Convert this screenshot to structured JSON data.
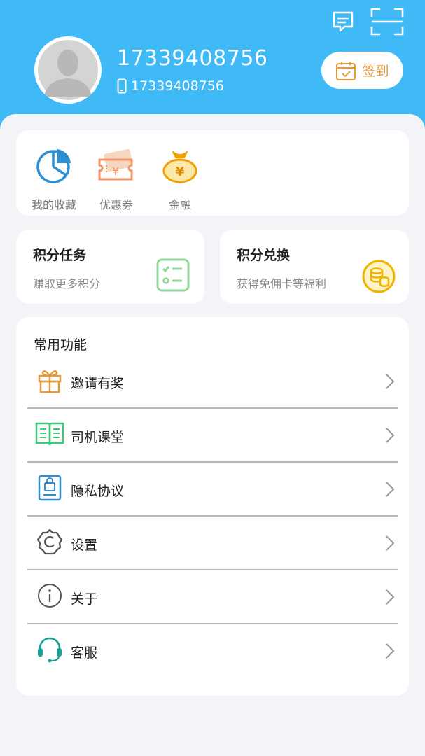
{
  "header": {
    "username": "17339408756",
    "phone": "17339408756",
    "checkin_label": "签到"
  },
  "quick_actions": [
    {
      "label": "我的收藏",
      "icon": "pie-chart-icon"
    },
    {
      "label": "优惠券",
      "icon": "coupon-icon"
    },
    {
      "label": "金融",
      "icon": "money-bag-icon"
    }
  ],
  "points_task": {
    "title": "积分任务",
    "subtitle": "赚取更多积分"
  },
  "points_exchange": {
    "title": "积分兑换",
    "subtitle": "获得免佣卡等福利"
  },
  "functions": {
    "title": "常用功能",
    "items": [
      {
        "label": "邀请有奖",
        "icon": "gift-icon"
      },
      {
        "label": "司机课堂",
        "icon": "book-icon"
      },
      {
        "label": "隐私协议",
        "icon": "privacy-lock-icon"
      },
      {
        "label": "设置",
        "icon": "gear-icon"
      },
      {
        "label": "关于",
        "icon": "info-icon"
      },
      {
        "label": "客服",
        "icon": "headset-icon"
      }
    ]
  },
  "colors": {
    "header_bg": "#3fbaf6",
    "accent_orange": "#e29a3d",
    "page_bg": "#f2f4f7"
  }
}
